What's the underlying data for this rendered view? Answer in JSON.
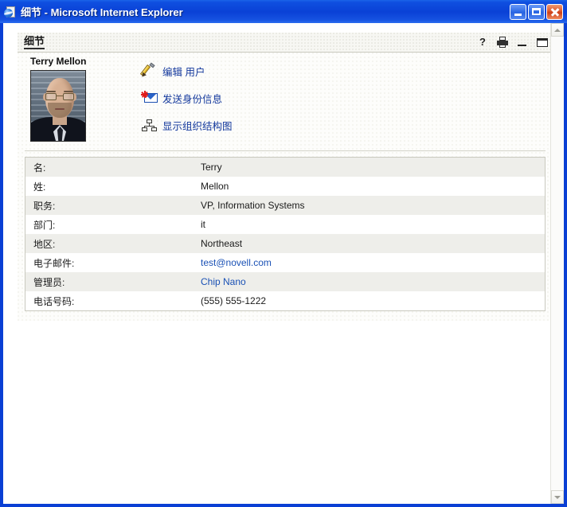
{
  "window": {
    "title_doc": "细节",
    "title_sep": " - ",
    "title_app": "Microsoft Internet Explorer",
    "icon": "ie-page-icon",
    "buttons": {
      "minimize": "最小化",
      "maximize": "最大化",
      "close": "关闭"
    }
  },
  "panel": {
    "title": "细节",
    "tools": {
      "help": "?",
      "print": "打印",
      "minimize": "最小化",
      "maximize": "最大化"
    }
  },
  "person": {
    "name": "Terry Mellon",
    "photo_alt": "Terry Mellon 照片"
  },
  "actions": [
    {
      "icon": "pencil-icon",
      "label": "编辑  用户"
    },
    {
      "icon": "mail-send-icon",
      "label": "发送身份信息"
    },
    {
      "icon": "org-chart-icon",
      "label": "显示组织结构图"
    }
  ],
  "details": [
    {
      "label": "名:",
      "value": "Terry",
      "link": false
    },
    {
      "label": "姓:",
      "value": "Mellon",
      "link": false
    },
    {
      "label": "职务:",
      "value": "VP, Information Systems",
      "link": false
    },
    {
      "label": "部门:",
      "value": "it",
      "link": false
    },
    {
      "label": "地区:",
      "value": "Northeast",
      "link": false
    },
    {
      "label": "电子邮件:",
      "value": "test@novell.com",
      "link": true
    },
    {
      "label": "管理员:",
      "value": "Chip Nano",
      "link": true
    },
    {
      "label": "电话号码:",
      "value": "(555) 555-1222",
      "link": false
    }
  ],
  "scrollbar": {
    "up": "向上滚动",
    "down": "向下滚动"
  },
  "colors": {
    "titlebar_blue": "#0a41d6",
    "link_blue": "#13389c",
    "value_link_blue": "#1a51b5",
    "row_alt": "#eeeeea"
  }
}
